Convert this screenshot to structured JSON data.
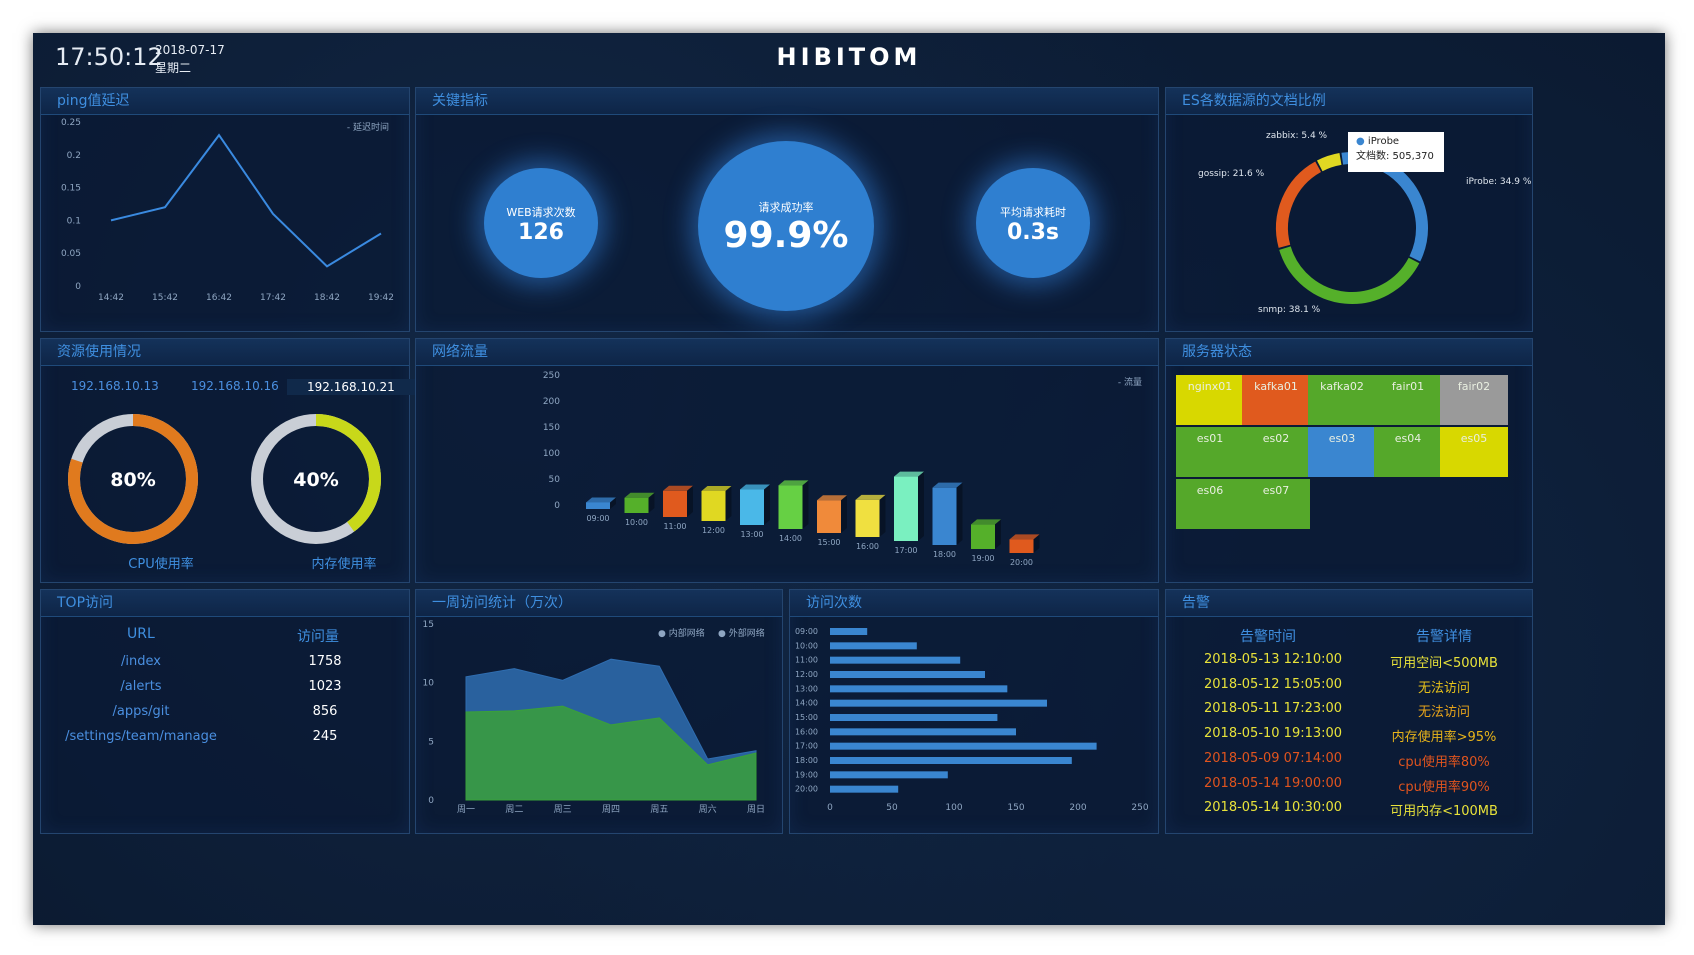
{
  "header": {
    "time": "17:50:12",
    "date": "2018-07-17",
    "weekday": "星期二",
    "logo": "HIBITOM"
  },
  "colors": {
    "accent": "#3f8fe0",
    "panel_bg": "#0d2140",
    "border": "#24456f",
    "bubble": "#2f7fd0"
  },
  "panels": {
    "ping": "ping值延迟",
    "kpi": "关键指标",
    "es": "ES各数据源的文档比例",
    "resource": "资源使用情况",
    "traffic": "网络流量",
    "server": "服务器状态",
    "top": "TOP访问",
    "weekly": "一周访问统计（万次）",
    "visits": "访问次数",
    "alarm": "告警"
  },
  "kpi": {
    "web_label": "WEB请求次数",
    "web_value": "126",
    "success_label": "请求成功率",
    "success_value": "99.9%",
    "avg_label": "平均请求耗时",
    "avg_value": "0.3s"
  },
  "resource": {
    "ips": [
      "192.168.10.13",
      "192.168.10.16",
      "192.168.10.21"
    ],
    "cpu_pct": 80,
    "cpu_value": "80%",
    "cpu_label": "CPU使用率",
    "mem_pct": 40,
    "mem_value": "40%",
    "mem_label": "内存使用率"
  },
  "servers": [
    {
      "name": "nginx01",
      "color": "#d8d800"
    },
    {
      "name": "kafka01",
      "color": "#e05a1e"
    },
    {
      "name": "kafka02",
      "color": "#55a82a"
    },
    {
      "name": "fair01",
      "color": "#55a82a"
    },
    {
      "name": "fair02",
      "color": "#9a9a9a"
    },
    {
      "name": "es01",
      "color": "#55a82a"
    },
    {
      "name": "es02",
      "color": "#55a82a"
    },
    {
      "name": "es03",
      "color": "#3a86d0"
    },
    {
      "name": "es04",
      "color": "#55a82a"
    },
    {
      "name": "es05",
      "color": "#d8d800"
    },
    {
      "name": "es06",
      "color": "#55a82a"
    },
    {
      "name": "es07",
      "color": "#55a82a"
    }
  ],
  "top": {
    "col_url": "URL",
    "col_count": "访问量",
    "rows": [
      {
        "url": "/index",
        "count": "1758"
      },
      {
        "url": "/alerts",
        "count": "1023"
      },
      {
        "url": "/apps/git",
        "count": "856"
      },
      {
        "url": "/settings/team/manage",
        "count": "245"
      }
    ]
  },
  "alarm": {
    "col_time": "告警时间",
    "col_detail": "告警详情",
    "rows": [
      {
        "time": "2018-05-13 12:10:00",
        "detail": "可用空间<500MB",
        "time_color": "#e8e23a",
        "detail_color": "#e8e23a"
      },
      {
        "time": "2018-05-12 15:05:00",
        "detail": "无法访问",
        "time_color": "#e8e23a",
        "detail_color": "#e8c21a"
      },
      {
        "time": "2018-05-11 17:23:00",
        "detail": "无法访问",
        "time_color": "#e8e23a",
        "detail_color": "#e8a41a"
      },
      {
        "time": "2018-05-10 19:13:00",
        "detail": "内存使用率>95%",
        "time_color": "#e8e23a",
        "detail_color": "#e8b41a"
      },
      {
        "time": "2018-05-09 07:14:00",
        "detail": "cpu使用率80%",
        "time_color": "#e0541e",
        "detail_color": "#e0541e"
      },
      {
        "time": "2018-05-14 19:00:00",
        "detail": "cpu使用率90%",
        "time_color": "#e0541e",
        "detail_color": "#e0541e"
      },
      {
        "time": "2018-05-14 10:30:00",
        "detail": "可用内存<100MB",
        "time_color": "#e8e23a",
        "detail_color": "#e8e23a"
      }
    ]
  },
  "chart_data": [
    {
      "id": "ping",
      "type": "line",
      "title": "",
      "x": [
        "14:42",
        "15:42",
        "16:42",
        "17:42",
        "18:42",
        "19:42"
      ],
      "series": [
        {
          "name": "延迟时间",
          "values": [
            0.1,
            0.12,
            0.23,
            0.11,
            0.03,
            0.08
          ],
          "color": "#3a8ae0"
        }
      ],
      "yticks": [
        "0",
        "0.05",
        "0.1",
        "0.15",
        "0.2",
        "0.25"
      ],
      "ylim": [
        0,
        0.25
      ]
    },
    {
      "id": "es",
      "type": "pie",
      "title": "",
      "slices": [
        {
          "label": "iProbe: 34.9 %",
          "value": 34.9,
          "color": "#3a86d0"
        },
        {
          "label": "snmp: 38.1 %",
          "value": 38.1,
          "color": "#55b02a"
        },
        {
          "label": "gossip: 21.6 %",
          "value": 21.6,
          "color": "#e05a1e"
        },
        {
          "label": "zabbix: 5.4 %",
          "value": 5.4,
          "color": "#e0d822"
        }
      ],
      "tooltip": {
        "name": "iProbe",
        "text": "文档数: 505,370"
      }
    },
    {
      "id": "traffic",
      "type": "bar",
      "title": "",
      "categories": [
        "09:00",
        "10:00",
        "11:00",
        "12:00",
        "13:00",
        "14:00",
        "15:00",
        "16:00",
        "17:00",
        "18:00",
        "19:00",
        "20:00"
      ],
      "series": [
        {
          "name": "流量",
          "values": [
            12,
            28,
            48,
            55,
            65,
            80,
            60,
            68,
            118,
            105,
            45,
            25
          ]
        }
      ],
      "colors": [
        "#3a86d0",
        "#55b02a",
        "#e05a1e",
        "#e0d822",
        "#4ab8e8",
        "#66d044",
        "#f08a3a",
        "#f0e040",
        "#7af0c0",
        "#3a86d0",
        "#55b02a",
        "#e05a1e"
      ],
      "yticks": [
        "0",
        "50",
        "100",
        "150",
        "200",
        "250"
      ],
      "ylim": [
        0,
        250
      ]
    },
    {
      "id": "weekly",
      "type": "area",
      "title": "",
      "categories": [
        "周一",
        "周二",
        "周三",
        "周四",
        "周五",
        "周六",
        "周日"
      ],
      "series": [
        {
          "name": "内部网络",
          "values": [
            10.5,
            11.2,
            10.2,
            12.0,
            11.4,
            3.5,
            4.2
          ],
          "color": "#2f6db0"
        },
        {
          "name": "外部网络",
          "values": [
            7.5,
            7.6,
            8.0,
            6.4,
            7.0,
            3.0,
            4.0
          ],
          "color": "#3aa03a"
        }
      ],
      "yticks": [
        "0",
        "5",
        "10",
        "15"
      ],
      "ylim": [
        0,
        15
      ]
    },
    {
      "id": "visits",
      "type": "bar",
      "title": "",
      "orientation": "horizontal",
      "categories": [
        "09:00",
        "10:00",
        "11:00",
        "12:00",
        "13:00",
        "14:00",
        "15:00",
        "16:00",
        "17:00",
        "18:00",
        "19:00",
        "20:00"
      ],
      "values": [
        30,
        70,
        105,
        125,
        143,
        175,
        135,
        150,
        215,
        195,
        95,
        55
      ],
      "xticks": [
        "0",
        "50",
        "100",
        "150",
        "200",
        "250"
      ],
      "xlim": [
        0,
        250
      ],
      "color": "#3a86d0"
    }
  ]
}
